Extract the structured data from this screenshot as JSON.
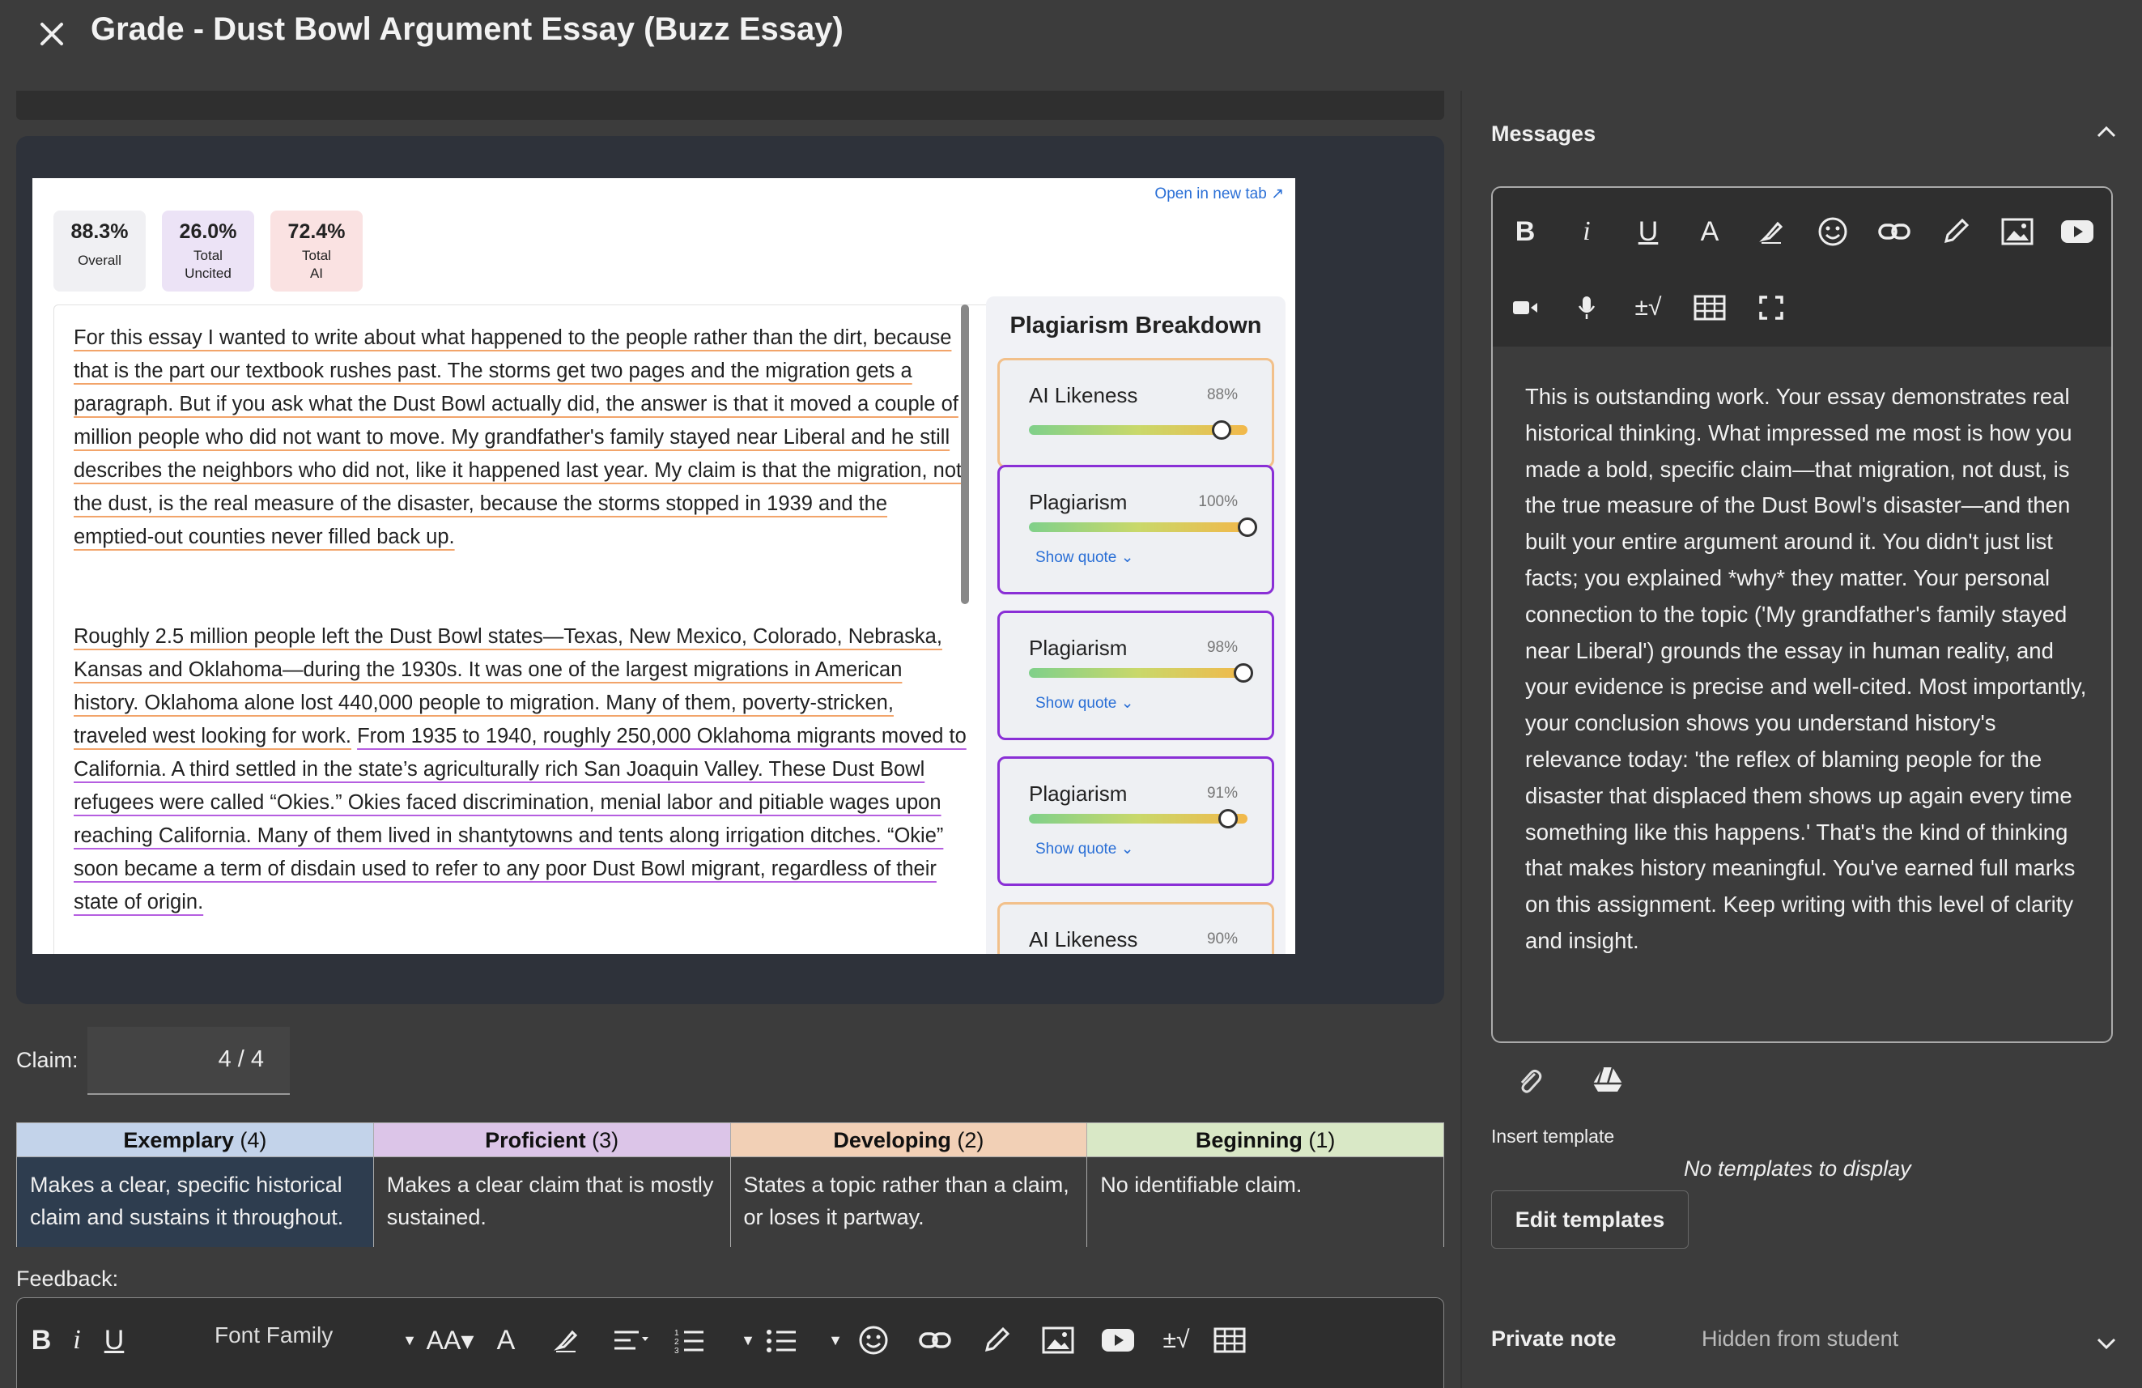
{
  "header": {
    "title": "Grade - Dust Bowl Argument Essay (Buzz Essay)"
  },
  "report": {
    "open_new_tab": "Open in new tab ↗",
    "scores": [
      {
        "pct": "88.3%",
        "label_line1": "Overall",
        "label_line2": "",
        "color": "#f0f0f3"
      },
      {
        "pct": "26.0%",
        "label_line1": "Total",
        "label_line2": "Uncited",
        "color": "#ece3f6"
      },
      {
        "pct": "72.4%",
        "label_line1": "Total",
        "label_line2": "AI",
        "color": "#fae2e2"
      }
    ],
    "essay": {
      "p1": "For this essay I wanted to write about what happened to the people rather than the dirt, because that is the part our textbook rushes past. The storms get two pages and the migration gets a paragraph. But if you ask what the Dust Bowl actually did, the answer is that it moved a couple of million people who did not want to move. My grandfather's family stayed near Liberal and he still describes the neighbors who did not, like it happened last year. My claim is that the migration, not the dust, is the real measure of the disaster, because the storms stopped in 1939 and the emptied-out counties never filled back up.",
      "p2a": "Roughly 2.5 million people left the Dust Bowl states—Texas, New Mexico, Colorado, Nebraska, Kansas and Oklahoma—during the 1930s. It was one of the largest migrations in American history. Oklahoma alone lost 440,000 people to migration. Many of them, poverty-stricken, traveled west looking for work.",
      "p2b": "From 1935 to 1940, roughly 250,000 Oklahoma migrants moved to California. A third settled in the state’s agriculturally rich San Joaquin Valley. These Dust Bowl refugees were called “Okies.” Okies faced discrimination, menial labor and pitiable wages upon reaching California. Many of them lived in shantytowns and tents along irrigation ditches. “Okie” soon became a term of disdain used to refer to any poor Dust Bowl migrant, regardless of their state of origin."
    },
    "breakdown": {
      "title": "Plagiarism Breakdown",
      "cards": [
        {
          "title": "AI Likeness",
          "pct": "88%",
          "value": 0.88,
          "show_quote": "",
          "border": "#f2c08a"
        },
        {
          "title": "Plagiarism",
          "pct": "100%",
          "value": 1.0,
          "show_quote": "Show quote",
          "border": "#8a2fd6"
        },
        {
          "title": "Plagiarism",
          "pct": "98%",
          "value": 0.98,
          "show_quote": "Show quote",
          "border": "#8a2fd6"
        },
        {
          "title": "Plagiarism",
          "pct": "91%",
          "value": 0.91,
          "show_quote": "Show quote",
          "border": "#8a2fd6"
        },
        {
          "title": "AI Likeness",
          "pct": "90%",
          "value": 0.9,
          "show_quote": "",
          "border": "#f2c08a"
        }
      ]
    }
  },
  "grading": {
    "claim_label": "Claim:",
    "claim_score": "4 / 4",
    "rubric": [
      {
        "name": "Exemplary",
        "points": "(4)",
        "desc": "Makes a clear, specific historical claim and sustains it throughout.",
        "head_color": "#c3d3ea",
        "body_color": "#2e3d4f"
      },
      {
        "name": "Proficient",
        "points": "(3)",
        "desc": "Makes a clear claim that is mostly sustained.",
        "head_color": "#dcc5e8",
        "body_color": "#3c3c3c"
      },
      {
        "name": "Developing",
        "points": "(2)",
        "desc": "States a topic rather than a claim, or loses it partway.",
        "head_color": "#f2d0b6",
        "body_color": "#3c3c3c"
      },
      {
        "name": "Beginning",
        "points": "(1)",
        "desc": "No identifiable claim.",
        "head_color": "#d9e8c6",
        "body_color": "#3c3c3c"
      }
    ],
    "feedback_label": "Feedback:",
    "font_family_label": "Font Family"
  },
  "messages": {
    "title": "Messages",
    "body": "This is outstanding work. Your essay demonstrates real historical thinking. What impressed me most is how you made a bold, specific claim—that migration, not dust, is the true measure of the Dust Bowl's disaster—and then built your entire argument around it. You didn't just list facts; you explained *why* they matter. Your personal connection to the topic ('My grandfather's family stayed near Liberal') grounds the essay in human reality, and your evidence is precise and well-cited. Most importantly, your conclusion shows you understand history's relevance today: 'the reflex of blaming people for the disaster that displaced them shows up again every time something like this happens.' That's the kind of thinking that makes history meaningful. You've earned full marks on this assignment. Keep writing with this level of clarity and insight.",
    "insert_template": "Insert template",
    "no_templates": "No templates to display",
    "edit_templates": "Edit templates",
    "private_note": "Private note",
    "hidden_from_student": "Hidden from student"
  }
}
